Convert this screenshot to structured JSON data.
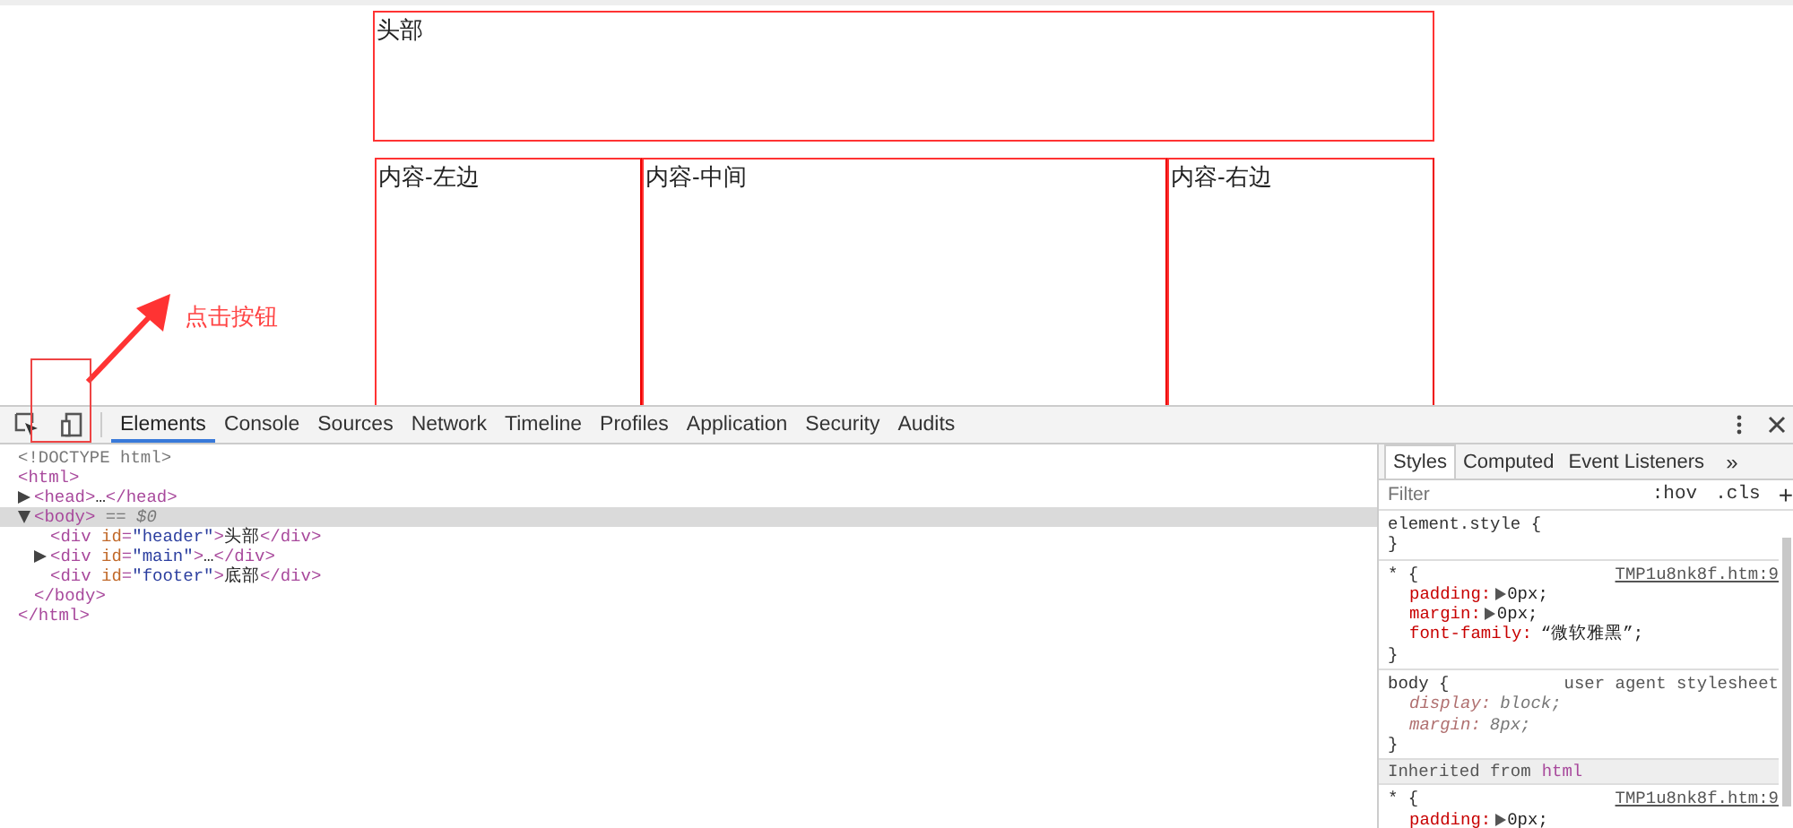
{
  "page": {
    "header_box": "头部",
    "content_boxes": [
      "内容-左边",
      "内容-中间",
      "内容-右边"
    ]
  },
  "annotation": {
    "text": "点击按钮"
  },
  "devtools": {
    "tabs": [
      {
        "label": "Elements",
        "selected": true
      },
      {
        "label": "Console",
        "selected": false
      },
      {
        "label": "Sources",
        "selected": false
      },
      {
        "label": "Network",
        "selected": false
      },
      {
        "label": "Timeline",
        "selected": false
      },
      {
        "label": "Profiles",
        "selected": false
      },
      {
        "label": "Application",
        "selected": false
      },
      {
        "label": "Security",
        "selected": false
      },
      {
        "label": "Audits",
        "selected": false
      }
    ],
    "dom_tree": [
      {
        "selected": false,
        "open": [
          {
            "t": "<!DOCTYPE html>",
            "kind": "comment"
          }
        ]
      },
      {
        "selected": false,
        "open": [
          {
            "t": "<html>",
            "kind": "tag"
          }
        ],
        "close": [
          {
            "t": "</html>",
            "kind": "tag"
          }
        ],
        "children": [
          {
            "expanded": false,
            "selected": false,
            "open": [
              {
                "t": "<head>",
                "kind": "tag"
              },
              {
                "t": "…",
                "kind": "text"
              },
              {
                "t": "</head>",
                "kind": "tag"
              }
            ]
          },
          {
            "expanded": true,
            "selected": true,
            "open": [
              {
                "t": "<body>",
                "kind": "tag"
              },
              {
                "t": " == $0",
                "kind": "marker"
              }
            ],
            "close": [
              {
                "t": "</body>",
                "kind": "tag"
              }
            ],
            "children": [
              {
                "selected": false,
                "open": [
                  {
                    "t": "<div ",
                    "kind": "tag"
                  },
                  {
                    "t": "id",
                    "kind": "attr"
                  },
                  {
                    "t": "=",
                    "kind": "tag"
                  },
                  {
                    "t": "\"header\"",
                    "kind": "value"
                  },
                  {
                    "t": ">",
                    "kind": "tag"
                  },
                  {
                    "t": "头部",
                    "kind": "text"
                  },
                  {
                    "t": "</div>",
                    "kind": "tag"
                  }
                ]
              },
              {
                "expanded": false,
                "selected": false,
                "open": [
                  {
                    "t": "<div ",
                    "kind": "tag"
                  },
                  {
                    "t": "id",
                    "kind": "attr"
                  },
                  {
                    "t": "=",
                    "kind": "tag"
                  },
                  {
                    "t": "\"main\"",
                    "kind": "value"
                  },
                  {
                    "t": ">",
                    "kind": "tag"
                  },
                  {
                    "t": "…",
                    "kind": "text"
                  },
                  {
                    "t": "</div>",
                    "kind": "tag"
                  }
                ]
              },
              {
                "selected": false,
                "open": [
                  {
                    "t": "<div ",
                    "kind": "tag"
                  },
                  {
                    "t": "id",
                    "kind": "attr"
                  },
                  {
                    "t": "=",
                    "kind": "tag"
                  },
                  {
                    "t": "\"footer\"",
                    "kind": "value"
                  },
                  {
                    "t": ">",
                    "kind": "tag"
                  },
                  {
                    "t": "底部",
                    "kind": "text"
                  },
                  {
                    "t": "</div>",
                    "kind": "tag"
                  }
                ]
              }
            ]
          }
        ]
      }
    ],
    "styles_pane": {
      "tabs": [
        {
          "label": "Styles",
          "selected": true
        },
        {
          "label": "Computed",
          "selected": false
        },
        {
          "label": "Event Listeners",
          "selected": false
        }
      ],
      "more": "»",
      "filter": {
        "placeholder": "Filter"
      },
      "filter_buttons": [
        ":hov",
        ".cls",
        "+"
      ],
      "sections": [
        {
          "kind": "rule",
          "selector": "element.style {",
          "close": "}"
        },
        {
          "kind": "rule",
          "selector": "* {",
          "source": "TMP1u8nk8f.htm:9",
          "close": "}",
          "props": [
            {
              "name": "padding:",
              "value": "0px;",
              "expandable": true,
              "overridden": false
            },
            {
              "name": "margin:",
              "value": "0px;",
              "expandable": true,
              "overridden": false
            },
            {
              "name": "font-family:",
              "value": "“微软雅黑”;",
              "expandable": false,
              "overridden": false
            }
          ]
        },
        {
          "kind": "rule",
          "selector": "body {",
          "source": "user agent stylesheet",
          "close": "}",
          "props": [
            {
              "name": "display:",
              "value": "block;",
              "expandable": false,
              "overridden": true
            },
            {
              "name": "margin:",
              "value": "8px;",
              "expandable": false,
              "overridden": true
            }
          ]
        },
        {
          "kind": "inherited",
          "label": "Inherited from",
          "tag": "html"
        },
        {
          "kind": "rule",
          "selector": "* {",
          "source": "TMP1u8nk8f.htm:9",
          "props": [
            {
              "name": "padding:",
              "value": "0px;",
              "expandable": true,
              "overridden": false
            }
          ]
        }
      ]
    }
  }
}
